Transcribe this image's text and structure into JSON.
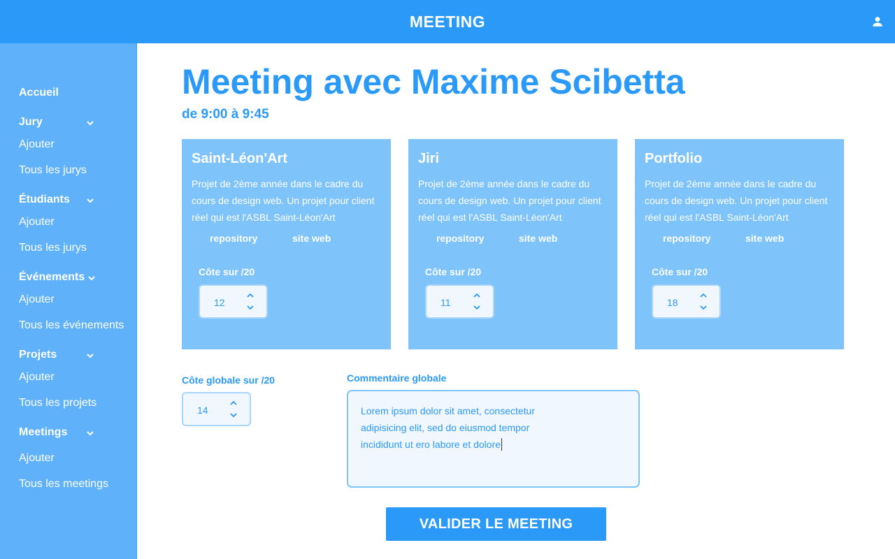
{
  "header": {
    "title": "MEETING",
    "user_icon": "user-icon"
  },
  "sidebar": {
    "accueil": "Accueil",
    "sections": [
      {
        "label": "Jury",
        "items": [
          "Ajouter",
          "Tous les jurys"
        ]
      },
      {
        "label": "Étudiants",
        "items": [
          "Ajouter",
          "Tous les jurys"
        ]
      },
      {
        "label": "Événements",
        "items": [
          "Ajouter",
          "Tous les événements"
        ]
      },
      {
        "label": "Projets",
        "items": [
          "Ajouter",
          "Tous les projets"
        ]
      },
      {
        "label": "Meetings",
        "items": [
          "Ajouter",
          "Tous les meetings"
        ]
      }
    ]
  },
  "main": {
    "title": "Meeting avec Maxime Scibetta",
    "subtitle": "de 9:00 à 9:45",
    "projects": [
      {
        "title": "Saint-Léon'Art",
        "description": "Projet de 2ème année dans le cadre du cours de design web. Un projet pour client réel qui est l'ASBL Saint-Léon'Art",
        "repo_label": "repository",
        "site_label": "site web",
        "grade_label": "Côte sur /20",
        "grade": "12"
      },
      {
        "title": "Jiri",
        "description": "Projet de 2ème année dans le cadre du cours de design web. Un projet pour client réel qui est l'ASBL Saint-Léon'Art",
        "repo_label": "repository",
        "site_label": "site web",
        "grade_label": "Côte sur /20",
        "grade": "11"
      },
      {
        "title": "Portfolio",
        "description": "Projet de 2ème année dans le cadre du cours de design web. Un projet pour client réel qui est l'ASBL Saint-Léon'Art",
        "repo_label": "repository",
        "site_label": "site web",
        "grade_label": "Côte sur /20",
        "grade": "18"
      }
    ],
    "global_grade_label": "Côte globale sur /20",
    "global_grade": "14",
    "comment_label": "Commentaire globale",
    "comment_lines": [
      "Lorem ipsum dolor sit amet, consectetur",
      "adipisicing elit, sed do eiusmod tempor",
      "incididunt ut ero labore et dolore"
    ],
    "submit_label": "VALIDER LE MEETING"
  },
  "colors": {
    "primary": "#2b99f8",
    "sidebar": "#5fb1f9",
    "card": "#7ec4fb",
    "field_bg": "#f0f7fe"
  }
}
